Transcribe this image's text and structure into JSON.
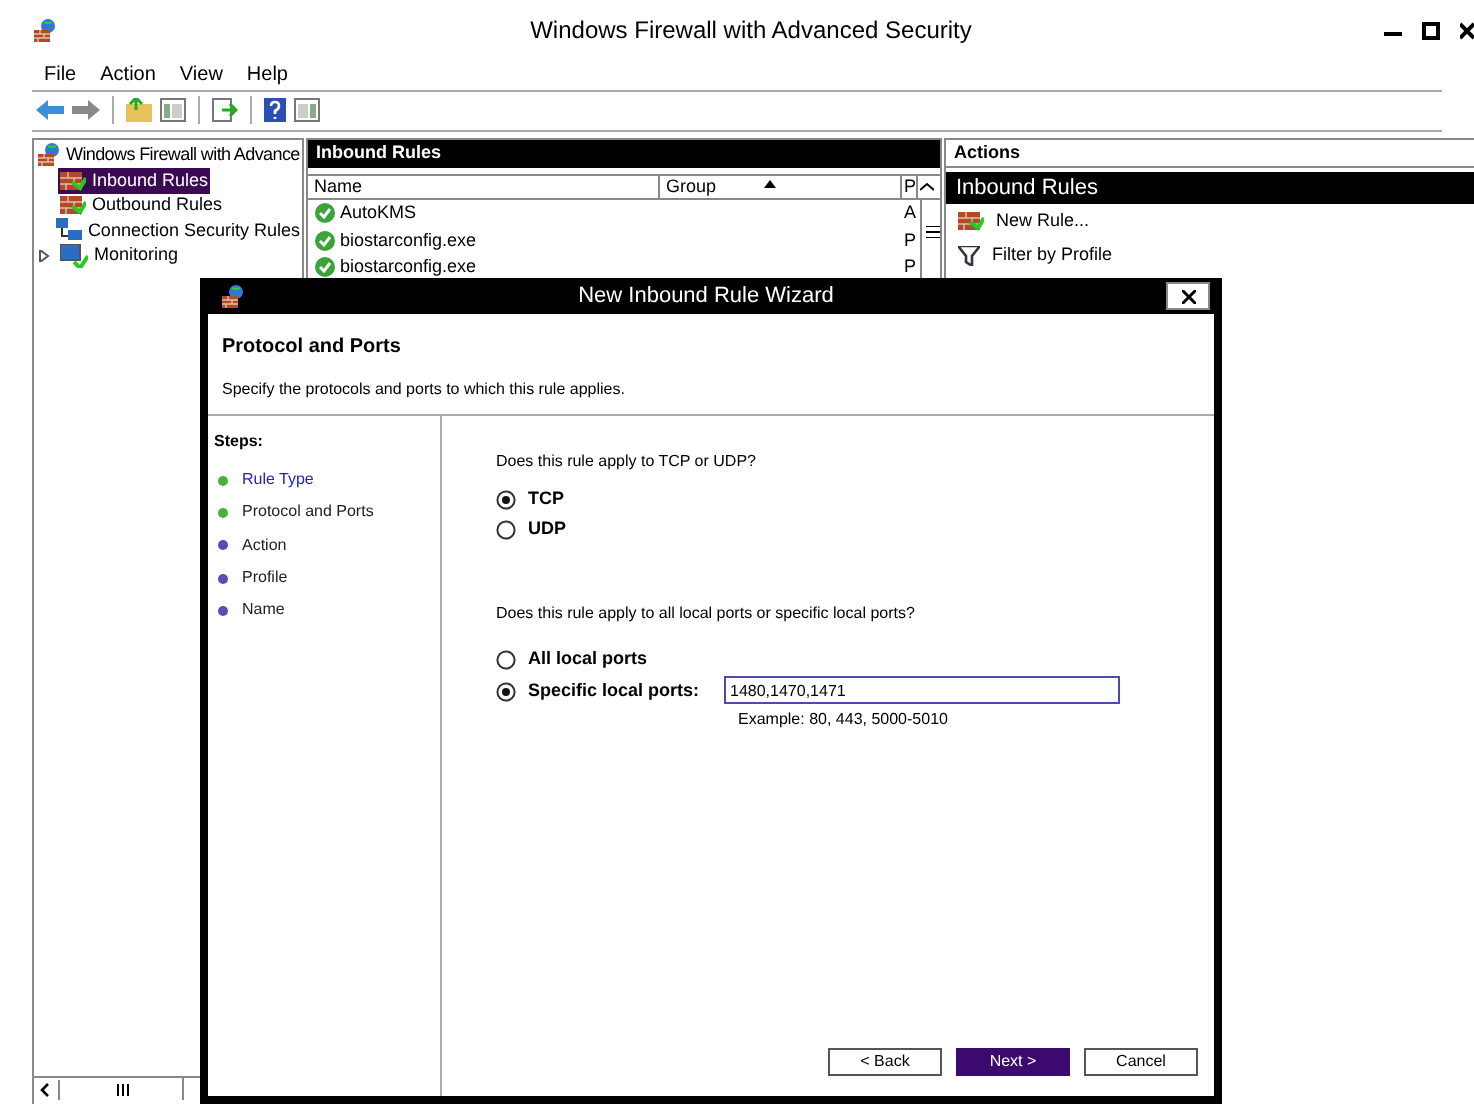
{
  "window": {
    "title": "Windows Firewall with Advanced Security"
  },
  "menu": [
    "File",
    "Action",
    "View",
    "Help"
  ],
  "tree": {
    "label": "Windows Firewall with Advance",
    "children": [
      {
        "label": "Inbound Rules",
        "selected": true
      },
      {
        "label": "Outbound Rules",
        "selected": false
      },
      {
        "label": "Connection Security Rules",
        "selected": false
      },
      {
        "label": "Monitoring",
        "selected": false,
        "expanded": false
      }
    ]
  },
  "rules": {
    "title": "Inbound Rules",
    "columns": [
      "Name",
      "Group",
      "P"
    ],
    "rows": [
      {
        "name": "AutoKMS",
        "column_3": "A"
      },
      {
        "name": "biostarconfig.exe",
        "column_3": "P"
      },
      {
        "name": "biostarconfig.exe",
        "column_3": "P"
      }
    ]
  },
  "actions": {
    "title": "Actions",
    "section": "Inbound Rules",
    "items": [
      {
        "label": "New Rule...",
        "kind": "new"
      },
      {
        "label": "Filter by Profile",
        "kind": "filter"
      }
    ]
  },
  "dialog": {
    "title": "New Inbound Rule Wizard",
    "heading": "Protocol and Ports",
    "subtitle": "Specify the protocols and ports to which this rule applies.",
    "steps_title": "Steps:",
    "steps": [
      {
        "label": "Rule Type",
        "done": true,
        "link": true
      },
      {
        "label": "Protocol and Ports",
        "done": true,
        "link": false
      },
      {
        "label": "Action",
        "done": false,
        "link": false
      },
      {
        "label": "Profile",
        "done": false,
        "link": false
      },
      {
        "label": "Name",
        "done": false,
        "link": false
      }
    ],
    "question_1": "Does this rule apply to TCP or UDP?",
    "protocols": [
      {
        "label": "TCP",
        "selected": true
      },
      {
        "label": "UDP",
        "selected": false
      }
    ],
    "question_2": "Does this rule apply to all local ports or specific local ports?",
    "ports": [
      {
        "label": "All local ports",
        "selected": false
      },
      {
        "label": "Specific local ports:",
        "selected": true
      }
    ],
    "ports_value": "1480,1470,1471",
    "example": "Example: 80, 443, 5000-5010",
    "buttons": [
      {
        "label": "< Back",
        "default": false
      },
      {
        "label": "Next >",
        "default": true
      },
      {
        "label": "Cancel",
        "default": false
      }
    ]
  }
}
